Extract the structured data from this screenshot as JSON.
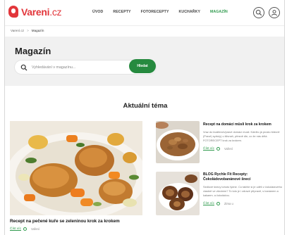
{
  "header": {
    "logo_name": "Vareni",
    "logo_tld": ".cz",
    "nav": [
      "Úvod",
      "Recepty",
      "Fotorecepty",
      "Kuchařky",
      "Magazín"
    ],
    "active_nav_index": 4,
    "icons": [
      "search-icon",
      "user-icon"
    ]
  },
  "breadcrumb": {
    "home": "Varení.cz",
    "separator": ">",
    "current": "Magazín"
  },
  "hero": {
    "title": "Magazín",
    "search_placeholder": "Vyhledávání v magazínu...",
    "search_button": "Hledat"
  },
  "section": {
    "title": "Aktuální téma"
  },
  "featured": {
    "title": "Recept na pečené kuře se zeleninou krok za krokem",
    "read_label": "Číst víc",
    "tag": "Vaření"
  },
  "articles": [
    {
      "title": "Recept na domácí müsli krok za krokem",
      "description": "Vraz do kvalitních/pravé domácí musli. Kdežto já prosto šťávně (Pravé) syrtuly) u šlivnaň, přesně dle, co že nás dělá. FOTORECEPT krok za krokem.",
      "read_label": "Číst víc",
      "tag": "Vaření"
    },
    {
      "title": "BLOG Rychle Fit Recepty: Čokoládovobanánové šnecí",
      "description": "Sedlové šnecy tohoto týdne. Co takhle si je udělí z čokoládového vlastně ve všedním? To kdo je i zdravé přípravě, s banánem a kakaem. a čokoládou.",
      "read_label": "Číst víc",
      "tag": "Zima u"
    }
  ],
  "colors": {
    "brand_red": "#e2363b",
    "accent_green": "#268a3f",
    "hero_bg": "#f1f1f1"
  }
}
